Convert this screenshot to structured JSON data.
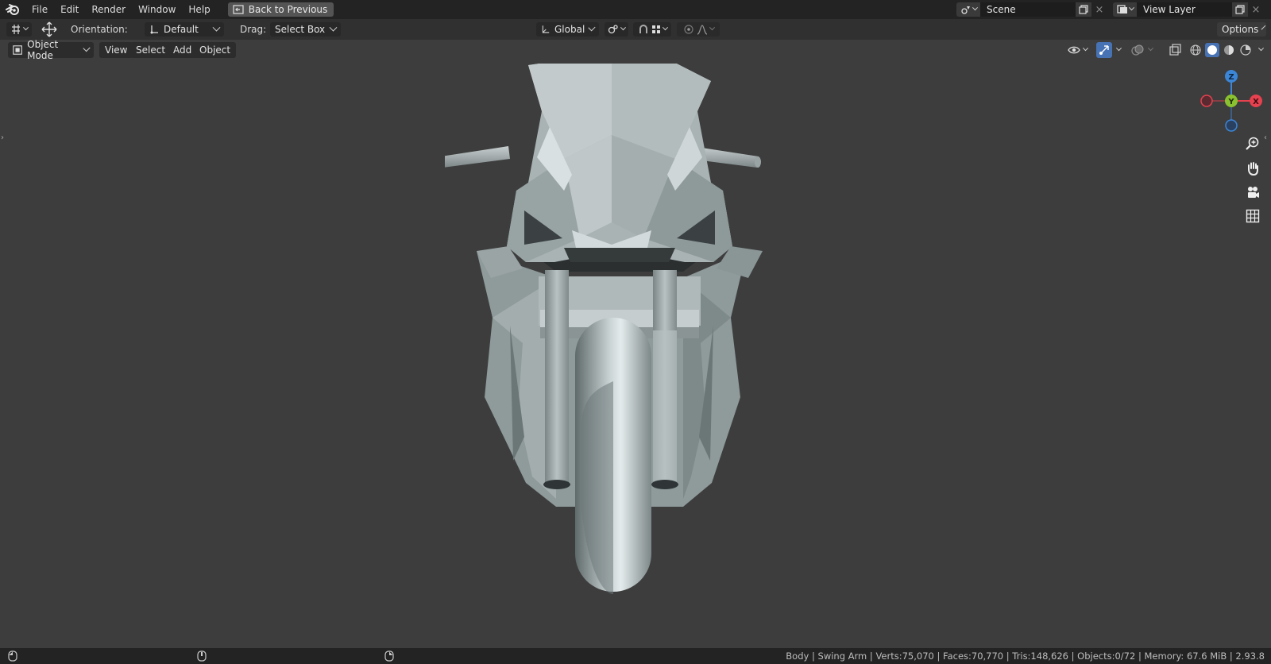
{
  "topbar": {
    "menus": [
      "File",
      "Edit",
      "Render",
      "Window",
      "Help"
    ],
    "back_button": "Back to Previous",
    "scene_name": "Scene",
    "view_layer_name": "View Layer"
  },
  "toolheader": {
    "orientation_label": "Orientation:",
    "orientation_value": "Default",
    "drag_label": "Drag:",
    "drag_value": "Select Box",
    "transform_orientation": "Global",
    "options_label": "Options"
  },
  "viewport_header": {
    "mode": "Object Mode",
    "menus": [
      "View",
      "Select",
      "Add",
      "Object"
    ]
  },
  "gizmo": {
    "axes": {
      "z": "Z",
      "y": "Y",
      "x": "X"
    },
    "colors": {
      "x": "#e5414f",
      "y": "#8ac130",
      "z": "#3c86d8"
    }
  },
  "navigation_icons": [
    "zoom-icon",
    "hand-icon",
    "camera-icon",
    "grid-icon"
  ],
  "statusbar": {
    "text": "Body | Swing Arm | Verts:75,070 | Faces:70,770 | Tris:148,626 | Objects:0/72 | Memory: 67.6 MiB | 2.93.8"
  },
  "colors": {
    "viewport_bg": "#3d3d3d",
    "topbar_bg": "#232323",
    "header_bg": "#303030",
    "accent_blue": "#4772b3"
  }
}
